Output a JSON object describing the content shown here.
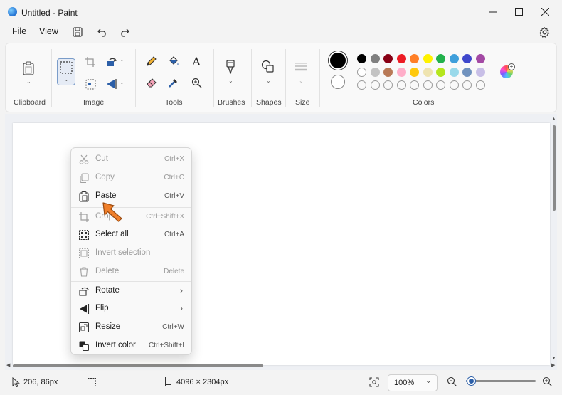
{
  "window": {
    "title": "Untitled - Paint"
  },
  "menu": {
    "file": "File",
    "view": "View"
  },
  "ribbon": {
    "groups": {
      "clipboard": "Clipboard",
      "image": "Image",
      "tools": "Tools",
      "brushes": "Brushes",
      "shapes": "Shapes",
      "size": "Size",
      "colors": "Colors"
    }
  },
  "palette": {
    "primary": "#000000",
    "secondary": "#ffffff",
    "row1": [
      "#000000",
      "#7f7f7f",
      "#880015",
      "#ed1c24",
      "#ff7f27",
      "#fff200",
      "#22b14c",
      "#3f9fdb",
      "#3f48cc",
      "#a349a4"
    ],
    "row2": [
      "#ffffff",
      "#c3c3c3",
      "#b97a57",
      "#ffaec9",
      "#ffc90e",
      "#efe4b0",
      "#b5e61d",
      "#99d9ea",
      "#7092be",
      "#c8bfe7"
    ],
    "row3_empty_count": 10
  },
  "context_menu": {
    "items": [
      {
        "label": "Cut",
        "shortcut": "Ctrl+X",
        "icon": "scissors-icon",
        "enabled": false
      },
      {
        "label": "Copy",
        "shortcut": "Ctrl+C",
        "icon": "copy-icon",
        "enabled": false
      },
      {
        "label": "Paste",
        "shortcut": "Ctrl+V",
        "icon": "clipboard-paste-icon",
        "enabled": true
      },
      {
        "label": "Crop",
        "shortcut": "Ctrl+Shift+X",
        "icon": "crop-icon",
        "enabled": false
      },
      {
        "label": "Select all",
        "shortcut": "Ctrl+A",
        "icon": "select-all-icon",
        "enabled": true
      },
      {
        "label": "Invert selection",
        "shortcut": "",
        "icon": "invert-selection-icon",
        "enabled": false
      },
      {
        "label": "Delete",
        "shortcut": "Delete",
        "icon": "trash-icon",
        "enabled": false
      },
      {
        "label": "Rotate",
        "shortcut": "",
        "icon": "rotate-icon",
        "enabled": true,
        "submenu": true
      },
      {
        "label": "Flip",
        "shortcut": "",
        "icon": "flip-icon",
        "enabled": true,
        "submenu": true
      },
      {
        "label": "Resize",
        "shortcut": "Ctrl+W",
        "icon": "resize-icon",
        "enabled": true
      },
      {
        "label": "Invert color",
        "shortcut": "Ctrl+Shift+I",
        "icon": "invert-color-icon",
        "enabled": true
      }
    ]
  },
  "status": {
    "cursor_position": "206, 86px",
    "canvas_size": "4096 × 2304px",
    "zoom": "100%",
    "zoom_slider_fraction": 0.07
  },
  "accent": "#2c5fa8"
}
